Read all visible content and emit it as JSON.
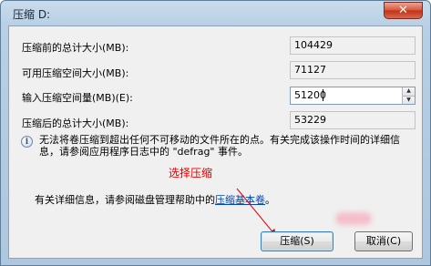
{
  "window": {
    "title": "压缩 D:",
    "close_glyph": "✕"
  },
  "fields": [
    {
      "label": "压缩前的总计大小(MB):",
      "value": "104429"
    },
    {
      "label": "可用压缩空间大小(MB):",
      "value": "71127"
    },
    {
      "label": "输入压缩空间量(MB)(E):",
      "value": "51200"
    },
    {
      "label": "压缩后的总计大小(MB):",
      "value": "53229"
    }
  ],
  "info": {
    "icon": "info-icon",
    "text": "无法将卷压缩到超出任何不可移动的文件所在的点。有关完成该操作时间的详细信息，请参阅应用程序日志中的 \"defrag\" 事件。"
  },
  "annotation": {
    "text": "选择压缩",
    "color": "#e30000"
  },
  "help": {
    "prefix": "有关详细信息，请参阅磁盘管理帮助中的",
    "link": "压缩基本卷",
    "suffix": "。"
  },
  "buttons": {
    "shrink": "压缩(S)",
    "cancel": "取消(C)"
  }
}
